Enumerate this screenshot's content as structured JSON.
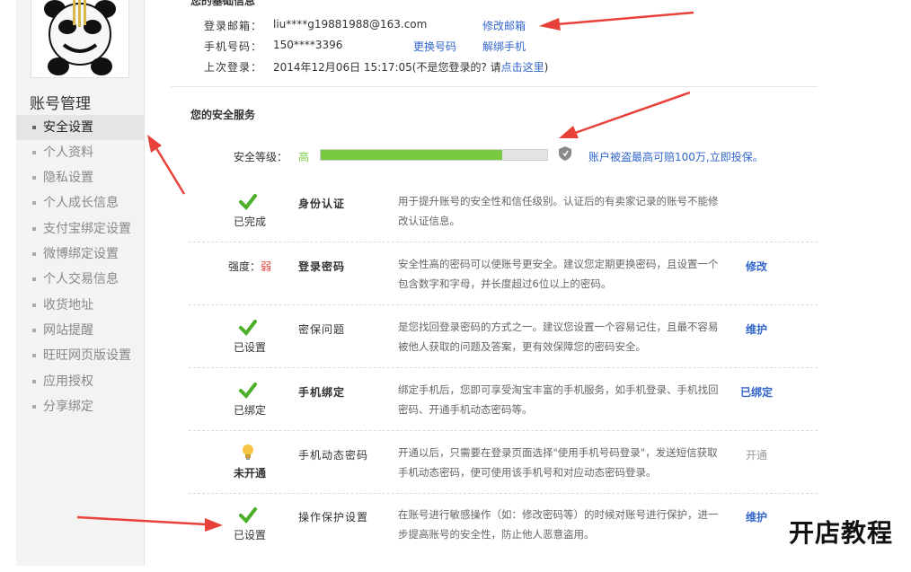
{
  "sidebar": {
    "title": "账号管理",
    "items": [
      {
        "label": "安全设置",
        "active": true
      },
      {
        "label": "个人资料"
      },
      {
        "label": "隐私设置"
      },
      {
        "label": "个人成长信息"
      },
      {
        "label": "支付宝绑定设置"
      },
      {
        "label": "微博绑定设置"
      },
      {
        "label": "个人交易信息"
      },
      {
        "label": "收货地址"
      },
      {
        "label": "网站提醒"
      },
      {
        "label": "旺旺网页版设置"
      },
      {
        "label": "应用授权"
      },
      {
        "label": "分享绑定"
      }
    ]
  },
  "basic": {
    "title": "您的基础信息",
    "email_label": "登录邮箱：",
    "email_value": "liu****g19881988@163.com",
    "email_action": "修改邮箱",
    "phone_label": "手机号码：",
    "phone_value": "150****3396",
    "phone_change": "更换号码",
    "phone_unbind": "解绑手机",
    "last_login_label": "上次登录：",
    "last_login_value": "2014年12月06日 15:17:05(不是您登录的? 请",
    "last_login_link": "点击这里",
    "last_login_tail": ")"
  },
  "security": {
    "title": "您的安全服务",
    "level_label": "安全等级：",
    "level_value": "高",
    "level_progress": 0.8,
    "insurance_link": "账户被盗最高可赔100万,立即投保。",
    "services": [
      {
        "status_icon": "check-icon",
        "status": "已完成",
        "name": "身份认证",
        "desc": "用于提升账号的安全性和信任级别。认证后的有卖家记录的账号不能修改认证信息。",
        "action": ""
      },
      {
        "status_prefix": "强度：",
        "status_strength": "弱",
        "name": "登录密码",
        "desc": "安全性高的密码可以使账号更安全。建议您定期更换密码，且设置一个包含数字和字母，并长度超过6位以上的密码。",
        "action": "修改"
      },
      {
        "status_icon": "check-icon",
        "status": "已设置",
        "name": "密保问题",
        "desc": "是您找回登录密码的方式之一。建议您设置一个容易记住，且最不容易被他人获取的问题及答案，更有效保障您的密码安全。",
        "action": "维护"
      },
      {
        "status_icon": "check-icon",
        "status": "已绑定",
        "name": "手机绑定",
        "desc": "绑定手机后，您即可享受淘宝丰富的手机服务，如手机登录、手机找回密码、开通手机动态密码等。",
        "action": "已绑定"
      },
      {
        "status_icon": "bulb-icon",
        "status": "未开通",
        "name": "手机动态密码",
        "desc": "开通以后，只需要在登录页面选择\"使用手机号码登录\"，发送短信获取手机动态密码，便可使用该手机号和对应动态密码登录。",
        "action": "开通"
      },
      {
        "status_icon": "check-icon",
        "status": "已设置",
        "name": "操作保护设置",
        "desc": "在账号进行敏感操作（如：修改密码等）的时候对账号进行保护，进一步提高账号的安全性，防止他人恶意盗用。",
        "action": "维护"
      }
    ]
  },
  "colors": {
    "accent": "#3366cc",
    "progress": "#7ac943",
    "arrow": "#e8413a"
  },
  "watermark": "开店教程"
}
